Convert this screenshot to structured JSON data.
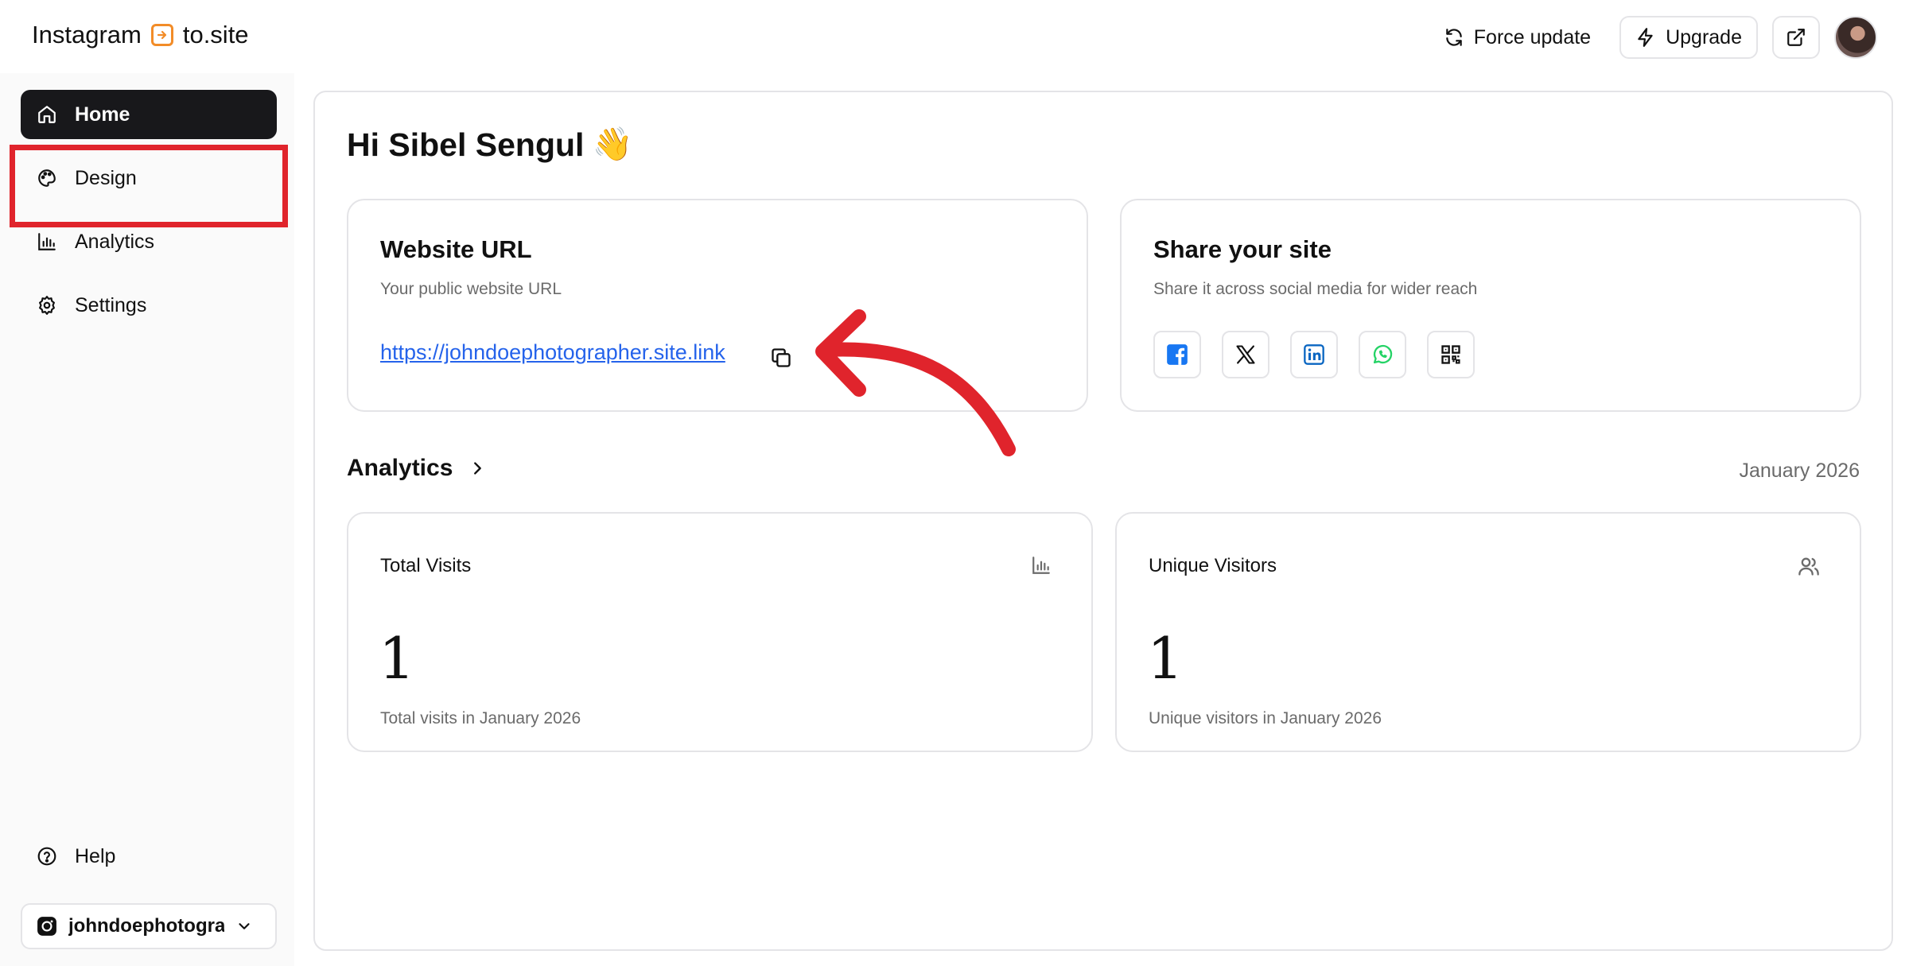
{
  "header": {
    "logo_left": "Instagram",
    "logo_right": "to.site",
    "force_update_label": "Force update",
    "upgrade_label": "Upgrade"
  },
  "sidebar": {
    "items": [
      {
        "label": "Home",
        "icon": "home-icon",
        "active": true
      },
      {
        "label": "Design",
        "icon": "palette-icon",
        "active": false
      },
      {
        "label": "Analytics",
        "icon": "bar-chart-icon",
        "active": false
      },
      {
        "label": "Settings",
        "icon": "gear-icon",
        "active": false
      }
    ],
    "help_label": "Help",
    "account": "johndoephotographer"
  },
  "main": {
    "greeting": "Hi Sibel Sengul",
    "greeting_emoji": "👋",
    "website_card": {
      "title": "Website URL",
      "subtitle": "Your public website URL",
      "url": "https://johndoephotographer.site.link"
    },
    "share_card": {
      "title": "Share your site",
      "subtitle": "Share it across social media for wider reach",
      "buttons": [
        "facebook-icon",
        "x-icon",
        "linkedin-icon",
        "whatsapp-icon",
        "qr-code-icon"
      ]
    },
    "analytics": {
      "title": "Analytics",
      "period": "January 2026",
      "total_visits": {
        "title": "Total Visits",
        "value": "1",
        "subtitle": "Total visits in January 2026"
      },
      "unique_visitors": {
        "title": "Unique Visitors",
        "value": "1",
        "subtitle": "Unique visitors in January 2026"
      }
    }
  },
  "colors": {
    "accent_dark": "#18181b",
    "link": "#2563eb",
    "annotation_red": "#e0242c",
    "logo_orange": "#f28c28"
  }
}
